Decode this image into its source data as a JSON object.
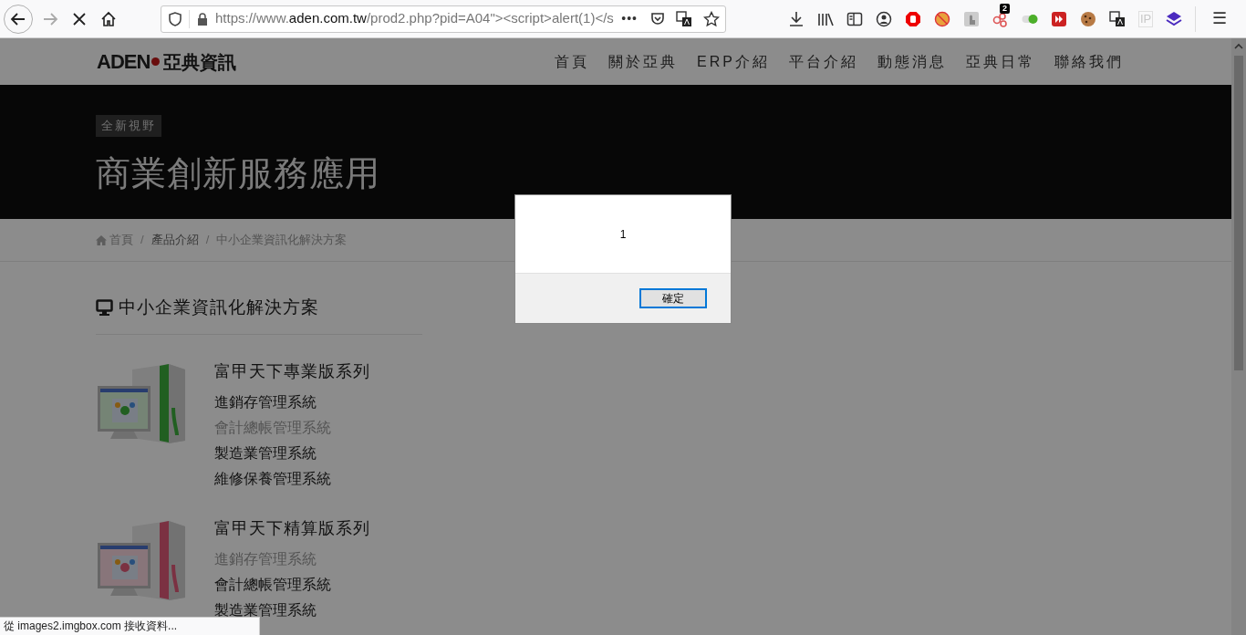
{
  "browser": {
    "url_scheme": "https://www.",
    "url_host": "aden.com.tw",
    "url_path": "/prod2.php?pid=A04\"><script>alert(1)</s",
    "page_actions": "•••",
    "badge": "2",
    "ip_label": "IP",
    "menu": "☰"
  },
  "site": {
    "logo_mark": "ADEN",
    "logo_text": "亞典資訊",
    "nav": [
      {
        "label": "首頁"
      },
      {
        "label": "關於亞典"
      },
      {
        "label": "ERP介紹"
      },
      {
        "label": "平台介紹"
      },
      {
        "label": "動態消息"
      },
      {
        "label": "亞典日常"
      },
      {
        "label": "聯絡我們"
      }
    ]
  },
  "hero": {
    "tag": "全新視野",
    "title": "商業創新服務應用"
  },
  "breadcrumb": [
    {
      "label": "首頁",
      "kind": "home"
    },
    {
      "separator": "/",
      "label": "產品介紹",
      "kind": "link"
    },
    {
      "separator": "/",
      "label": "中小企業資訊化解決方案",
      "kind": "current"
    }
  ],
  "section": {
    "title": "中小企業資訊化解決方案",
    "products": [
      {
        "title": "富甲天下專業版系列",
        "kind": "picture",
        "items": [
          {
            "label": "進銷存管理系統",
            "dimmed": false
          },
          {
            "label": "會計總帳管理系統",
            "dimmed": true
          },
          {
            "label": "製造業管理系統",
            "dimmed": false
          },
          {
            "label": "維修保養管理系統",
            "dimmed": false
          }
        ]
      },
      {
        "title": "富甲天下精算版系列",
        "kind": "picture",
        "items": [
          {
            "label": "進銷存管理系統",
            "dimmed": true
          },
          {
            "label": "會計總帳管理系統",
            "dimmed": false
          },
          {
            "label": "製造業管理系統",
            "dimmed": false
          }
        ]
      }
    ]
  },
  "alert": {
    "message": "1",
    "button": "確定"
  },
  "status_bar": "從 images2.imgbox.com 接收資料..."
}
